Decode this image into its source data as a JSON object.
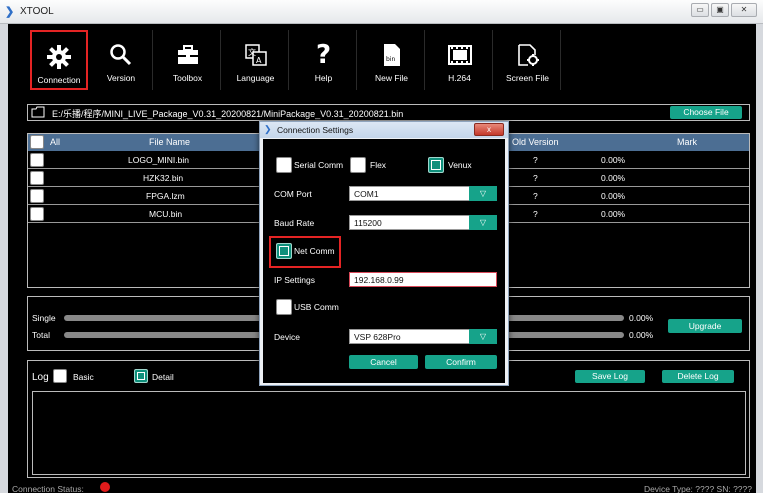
{
  "window": {
    "title": "XTOOL",
    "buttons": [
      "▭",
      "▣",
      "✕"
    ]
  },
  "toolbar": {
    "items": [
      {
        "label": "Connection",
        "icon": "gear-icon"
      },
      {
        "label": "Version",
        "icon": "search-icon"
      },
      {
        "label": "Toolbox",
        "icon": "toolbox-icon"
      },
      {
        "label": "Language",
        "icon": "language-icon"
      },
      {
        "label": "Help",
        "icon": "help-icon"
      },
      {
        "label": "New File",
        "icon": "bin-file-icon"
      },
      {
        "label": "H.264",
        "icon": "film-icon"
      },
      {
        "label": "Screen File",
        "icon": "screen-file-icon"
      }
    ],
    "selected": "Connection",
    "bin_label": "bin"
  },
  "file_path": {
    "value": "E:/乐播/程序/MINI_LIVE_Package_V0.31_20200821/MiniPackage_V0.31_20200821.bin",
    "choose_label": "Choose File"
  },
  "file_table": {
    "columns": {
      "all": "All",
      "file_name": "File Name",
      "old_version": "Old Version",
      "mark": "Mark"
    },
    "rows": [
      {
        "file_name": "LOGO_MINI.bin",
        "old_version": "?",
        "progress": "0.00%"
      },
      {
        "file_name": "HZK32.bin",
        "old_version": "?",
        "progress": "0.00%"
      },
      {
        "file_name": "FPGA.lzm",
        "old_version": "?",
        "progress": "0.00%"
      },
      {
        "file_name": "MCU.bin",
        "old_version": "?",
        "progress": "0.00%"
      }
    ]
  },
  "progress": {
    "single_label": "Single",
    "single_value": "0.00%",
    "total_label": "Total",
    "total_value": "0.00%",
    "upgrade_label": "Upgrade"
  },
  "log": {
    "title": "Log",
    "basic_label": "Basic",
    "detail_label": "Detail",
    "save_label": "Save Log",
    "delete_label": "Delete Log"
  },
  "status": {
    "connection_label": "Connection Status:",
    "device_info": "Device Type: ???? SN: ????",
    "connection_color": "#e01b1b"
  },
  "dialog": {
    "title": "Connection Settings",
    "close_label": "x",
    "serial_comm_label": "Serial Comm",
    "flex_label": "Flex",
    "venux_label": "Venux",
    "com_port_label": "COM Port",
    "com_port_value": "COM1",
    "baud_rate_label": "Baud Rate",
    "baud_rate_value": "115200",
    "net_comm_label": "Net Comm",
    "ip_settings_label": "IP Settings",
    "ip_value": "192.168.0.99",
    "usb_comm_label": "USB Comm",
    "device_label": "Device",
    "device_value": "VSP 628Pro",
    "cancel_label": "Cancel",
    "confirm_label": "Confirm",
    "dropdown_arrow": "▽"
  },
  "colors": {
    "accent": "#16a38a",
    "header": "#4c6e93",
    "highlight": "#e52424"
  }
}
